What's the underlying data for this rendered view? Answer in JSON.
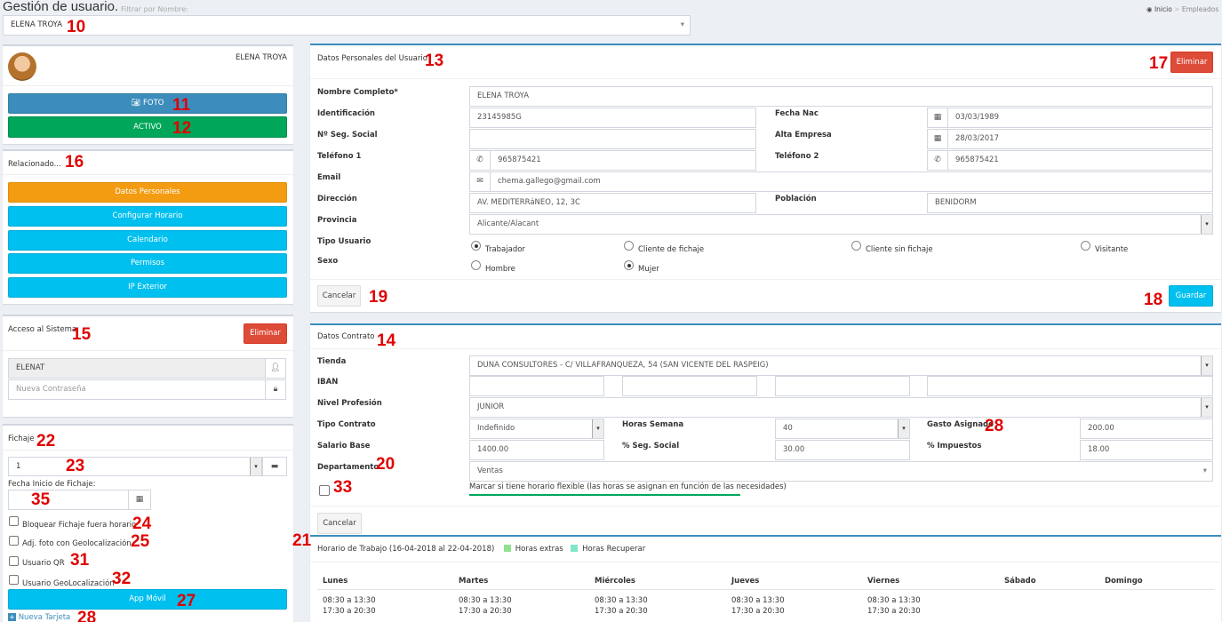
{
  "header": {
    "title": "Gestión de usuario.",
    "filter_label": "Filtrar por Nombre:",
    "breadcrumb_home": "Inicio",
    "breadcrumb_sep": ">",
    "breadcrumb_current": "Empleados"
  },
  "user_select": {
    "value": "ELENA TROYA",
    "arrow": "▾"
  },
  "profile": {
    "name": "ELENA TROYA",
    "photo_button": "FOTO",
    "status_button": "ACTIVO"
  },
  "related": {
    "title": "Relacionado...",
    "items": [
      "Datos Personales",
      "Configurar Horario",
      "Calendario",
      "Permisos",
      "IP Exterior"
    ]
  },
  "access": {
    "title": "Acceso al Sistema",
    "delete_button": "Eliminar",
    "username": "ELENAT",
    "password_placeholder": "Nueva Contraseña"
  },
  "fichaje": {
    "title": "Fichaje",
    "select_value": "1",
    "start_date_label": "Fecha Inicio de Fichaje:",
    "start_date_value": "",
    "checkboxes": [
      "Bloquear Fichaje fuera horario",
      "Adj. foto con Geolocalización",
      "Usuario QR",
      "Usuario GeoLocalización"
    ],
    "app_button": "App Móvil",
    "new_card": "Nueva Tarjeta"
  },
  "personal": {
    "title": "Datos Personales del Usuario",
    "delete_button": "Eliminar",
    "labels": {
      "full_name": "Nombre Completo*",
      "id": "Identificación",
      "birth": "Fecha Nac",
      "ss": "Nº Seg. Social",
      "hire": "Alta Empresa",
      "phone1": "Teléfono 1",
      "phone2": "Teléfono 2",
      "email": "Email",
      "address": "Dirección",
      "city": "Población",
      "province": "Provincia",
      "user_type": "Tipo Usuario",
      "sex": "Sexo"
    },
    "values": {
      "full_name": "ELENA TROYA",
      "id": "23145985G",
      "birth": "03/03/1989",
      "ss": "",
      "hire": "28/03/2017",
      "phone1": "965875421",
      "phone2": "965875421",
      "email": "chema.gallego@gmail.com",
      "address": "AV. MEDITERRáNEO, 12, 3C",
      "city": "BENIDORM",
      "province": "Alicante/Alacant"
    },
    "user_types": [
      "Trabajador",
      "Cliente de fichaje",
      "Cliente sin fichaje",
      "Visitante"
    ],
    "sexes": [
      "Hombre",
      "Mujer"
    ],
    "cancel_button": "Cancelar",
    "save_button": "Guardar"
  },
  "contract": {
    "title": "Datos Contrato",
    "labels": {
      "store": "Tienda",
      "iban": "IBAN",
      "level": "Nivel Profesión",
      "type": "Tipo Contrato",
      "hours": "Horas Semana",
      "expense": "Gasto Asignado",
      "salary": "Salario Base",
      "ss_pct": "% Seg. Social",
      "tax_pct": "% Impuestos",
      "department": "Departamento"
    },
    "values": {
      "store": "DUNA CONSULTORES - C/ VILLAFRANQUEZA, 54 (SAN VICENTE DEL RASPEIG)",
      "level": "JUNIOR",
      "type": "Indefinido",
      "hours": "40",
      "expense": "200.00",
      "salary": "1400.00",
      "ss_pct": "30.00",
      "tax_pct": "18.00",
      "department": "Ventas"
    },
    "flexible_label": "Marcar si tiene horario flexible (las horas se asignan en función de las necesidades)",
    "cancel_button": "Cancelar"
  },
  "schedule": {
    "title": "Horario de Trabajo (16-04-2018 al 22-04-2018)",
    "legend_extra": "Horas extras",
    "legend_recover": "Horas Recuperar",
    "days": [
      "Lunes",
      "Martes",
      "Miércoles",
      "Jueves",
      "Viernes",
      "Sábado",
      "Domingo"
    ],
    "slot1": "08:30 a 13:30",
    "slot2": "17:30 a 20:30"
  },
  "annotations": {
    "n10": "10",
    "n11": "11",
    "n12": "12",
    "n13": "13",
    "n14": "14",
    "n15": "15",
    "n16": "16",
    "n17": "17",
    "n18": "18",
    "n19": "19",
    "n20": "20",
    "n21": "21",
    "n22": "22",
    "n23": "23",
    "n24": "24",
    "n25": "25",
    "n27": "27",
    "n28": "28",
    "n28b": "28",
    "n31": "31",
    "n32": "32",
    "n33": "33",
    "n35": "35"
  },
  "colors": {
    "primary": "#3c8dbc",
    "success": "#00a65a",
    "info": "#00c0ef",
    "warning": "#f39c12",
    "danger": "#dd4b39",
    "annotation": "#e00000"
  }
}
